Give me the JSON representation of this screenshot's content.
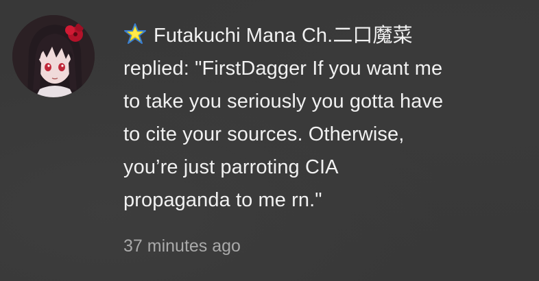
{
  "notification": {
    "channel_name": "Futakuchi Mana Ch.二口魔菜",
    "message_lines": [
      "replied: \"FirstDagger If you want me",
      "to take you seriously you gotta have",
      "to cite your sources. Otherwise,",
      "you’re just parroting CIA",
      "propaganda to me rn.\""
    ],
    "timestamp": "37 minutes ago",
    "avatar_icon": "channel-avatar-anime-girl",
    "badge_icon": "sparkle-star-icon"
  },
  "colors": {
    "background": "#383838",
    "text_primary": "#f1f1f1",
    "text_secondary": "#aaaaaa",
    "badge_star": "#f5d90a",
    "badge_outline": "#3a7fd0"
  }
}
